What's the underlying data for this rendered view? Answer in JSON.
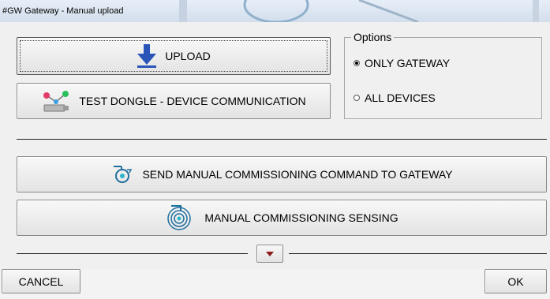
{
  "window": {
    "title": "#GW Gateway - Manual upload"
  },
  "buttons": {
    "upload": "UPLOAD",
    "test_dongle": "TEST DONGLE - DEVICE COMMUNICATION",
    "send_commissioning": "SEND MANUAL COMMISSIONING COMMAND TO GATEWAY",
    "commissioning_sensing": "MANUAL COMMISSIONING SENSING",
    "cancel": "CANCEL",
    "ok": "OK"
  },
  "options": {
    "legend": "Options",
    "items": [
      {
        "label": "ONLY GATEWAY",
        "selected": true
      },
      {
        "label": "ALL DEVICES",
        "selected": false
      }
    ]
  },
  "icons": {
    "upload": "download-arrow-icon",
    "test_dongle": "dongle-connection-icon",
    "send_commissioning": "send-commissioning-icon",
    "commissioning_sensing": "sensing-target-icon",
    "expand": "chevron-down-icon"
  },
  "colors": {
    "arrow_blue": "#2a55b8",
    "icon_teal": "#1f6f9e",
    "expand_arrow": "#8b1a1a"
  }
}
